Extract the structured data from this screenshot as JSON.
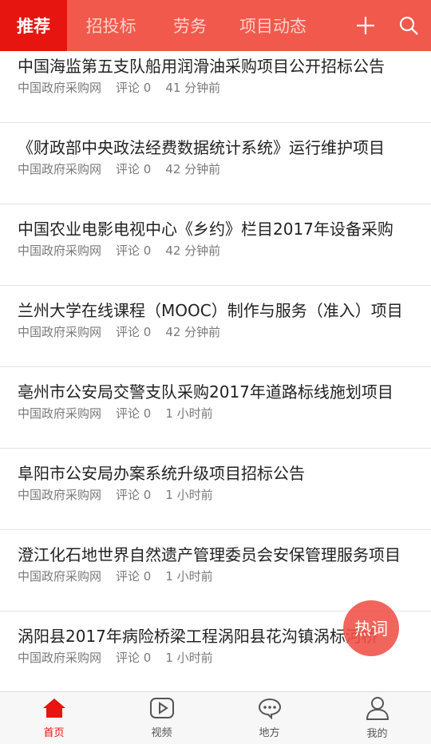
{
  "top_tabs": [
    "推荐",
    "招投标",
    "劳务",
    "项目动态"
  ],
  "header_icons": {
    "add": "plus-icon",
    "search": "search-icon"
  },
  "articles": [
    {
      "title": "中国海监第五支队船用润滑油采购项目公开招标公告",
      "source": "中国政府采购网",
      "comments": "评论 0",
      "time": "41 分钟前"
    },
    {
      "title": "《财政部中央政法经费数据统计系统》运行维护项目",
      "source": "中国政府采购网",
      "comments": "评论 0",
      "time": "42 分钟前"
    },
    {
      "title": "中国农业电影电视中心《乡约》栏目2017年设备采购",
      "source": "中国政府采购网",
      "comments": "评论 0",
      "time": "42 分钟前"
    },
    {
      "title": "兰州大学在线课程（MOOC）制作与服务（准入）项目",
      "source": "中国政府采购网",
      "comments": "评论 0",
      "time": "42 分钟前"
    },
    {
      "title": "亳州市公安局交警支队采购2017年道路标线施划项目",
      "source": "中国政府采购网",
      "comments": "评论 0",
      "time": "1 小时前"
    },
    {
      "title": "阜阳市公安局办案系统升级项目招标公告",
      "source": "中国政府采购网",
      "comments": "评论 0",
      "time": "1 小时前"
    },
    {
      "title": "澄江化石地世界自然遗产管理委员会安保管理服务项目",
      "source": "中国政府采购网",
      "comments": "评论 0",
      "time": "1 小时前"
    },
    {
      "title": "涡阳县2017年病险桥梁工程涡阳县花沟镇涡标河桥",
      "source": "中国政府采购网",
      "comments": "评论 0",
      "time": "1 小时前"
    }
  ],
  "fab": {
    "label": "热词"
  },
  "bottom_nav": [
    {
      "label": "首页",
      "icon": "home-icon"
    },
    {
      "label": "视频",
      "icon": "video-icon"
    },
    {
      "label": "地方",
      "icon": "chat-icon"
    },
    {
      "label": "我的",
      "icon": "profile-icon"
    }
  ],
  "colors": {
    "accent": "#e6150f",
    "header": "#f0594b"
  }
}
